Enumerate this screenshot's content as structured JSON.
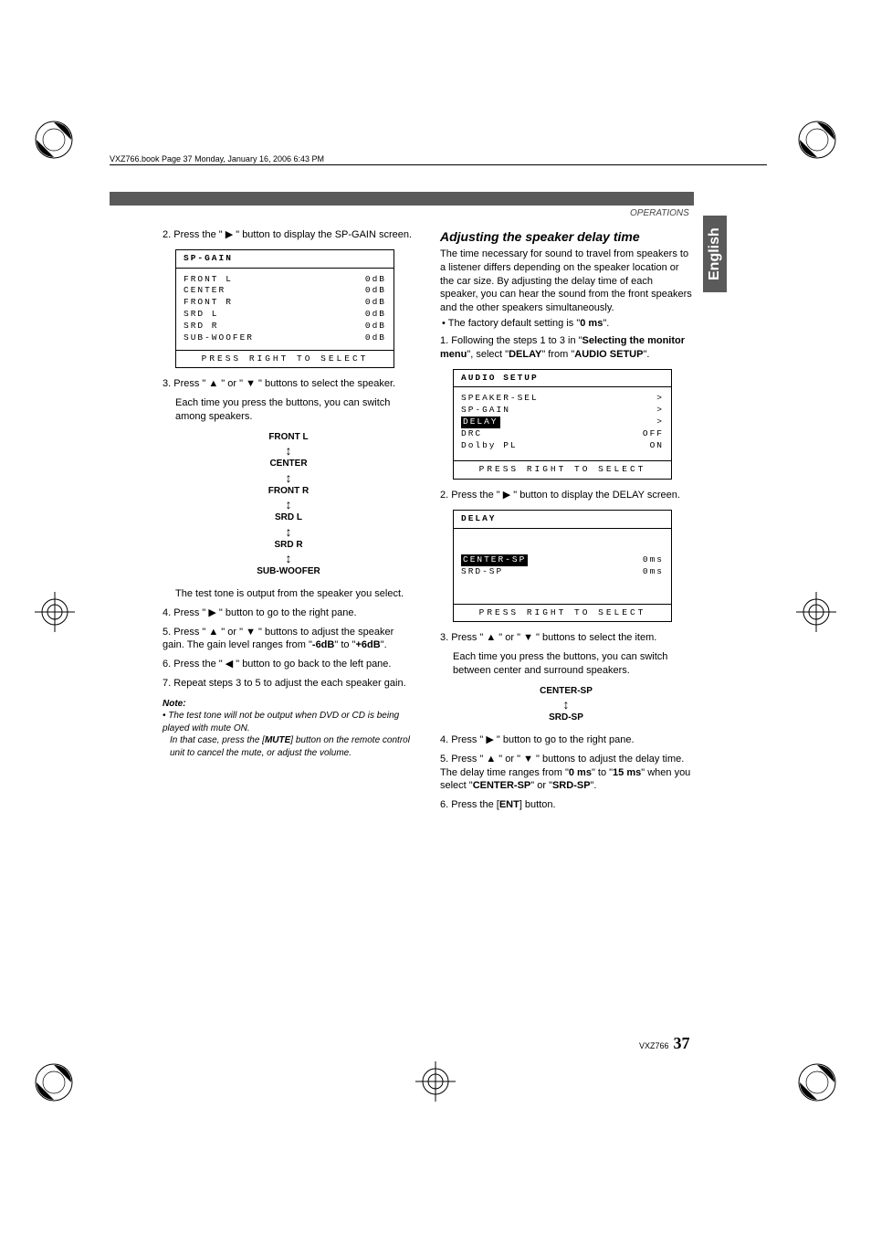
{
  "header": "VXZ766.book  Page 37  Monday, January 16, 2006  6:43 PM",
  "topLabel": "OPERATIONS",
  "sideTab": "English",
  "left": {
    "step2": "2. Press the \" ▶ \" button to display the SP-GAIN screen.",
    "menu1": {
      "title": "SP-GAIN",
      "rows": [
        {
          "lbl": "FRONT L",
          "val": "0dB"
        },
        {
          "lbl": "CENTER",
          "val": "0dB"
        },
        {
          "lbl": "FRONT R",
          "val": "0dB"
        },
        {
          "lbl": "SRD L",
          "val": "0dB"
        },
        {
          "lbl": "SRD R",
          "val": "0dB"
        },
        {
          "lbl": "SUB-WOOFER",
          "val": "0dB"
        }
      ],
      "footer": "PRESS RIGHT TO SELECT"
    },
    "step3a": "3. Press \" ▲ \" or \" ▼ \" buttons to select the speaker.",
    "step3b": "Each time you press the buttons, you can switch among speakers.",
    "flow": [
      "FRONT L",
      "CENTER",
      "FRONT R",
      "SRD L",
      "SRD R",
      "SUB-WOOFER"
    ],
    "afterFlow": "The test tone is output from the speaker you select.",
    "step4": "4. Press \" ▶ \" button to go to the right pane.",
    "step5a": "5. Press \" ▲ \" or \" ▼ \" buttons to adjust the speaker gain. The gain level ranges from \"",
    "step5b": "-6dB",
    "step5c": "\" to \"",
    "step5d": "+6dB",
    "step5e": "\".",
    "step6": "6. Press the \" ◀ \" button to go back to the left pane.",
    "step7": "7. Repeat steps 3 to 5 to adjust the each speaker gain.",
    "noteHd": "Note:",
    "note1": "• The test tone will not be output when DVD or CD is being played with mute ON.",
    "note2a": "In that case, press the [",
    "note2b": "MUTE",
    "note2c": "] button on the remote control unit to cancel the mute, or adjust the volume."
  },
  "right": {
    "title": "Adjusting the speaker delay time",
    "intro": "The time necessary for sound to travel from speakers to a listener differs depending on the speaker location or the car size. By adjusting the delay time of each speaker, you can hear the sound from the front speakers and the other speakers simultaneously.",
    "bullet1a": "The factory default setting is \"",
    "bullet1b": "0 ms",
    "bullet1c": "\".",
    "step1a": "1. Following the steps 1 to 3 in \"",
    "step1b": "Selecting the monitor menu",
    "step1c": "\", select \"",
    "step1d": "DELAY",
    "step1e": "\" from \"",
    "step1f": "AUDIO SETUP",
    "step1g": "\".",
    "menu1": {
      "title": "AUDIO SETUP",
      "rows": [
        {
          "lbl": "SPEAKER-SEL",
          "val": ">"
        },
        {
          "lbl": "SP-GAIN",
          "val": ">"
        },
        {
          "lbl": "DELAY",
          "val": ">",
          "hi": true
        },
        {
          "lbl": "DRC",
          "val": "OFF"
        },
        {
          "lbl": "Dolby PL",
          "val": "ON"
        }
      ],
      "footer": "PRESS RIGHT TO SELECT"
    },
    "step2": "2. Press the \" ▶ \" button to display the DELAY screen.",
    "menu2": {
      "title": "DELAY",
      "rows": [
        {
          "lbl": "CENTER-SP",
          "val": "0ms",
          "hi": true
        },
        {
          "lbl": "SRD-SP",
          "val": "0ms"
        }
      ],
      "footer": "PRESS RIGHT TO SELECT"
    },
    "step3a": "3. Press \" ▲ \" or \" ▼ \" buttons to select the item.",
    "step3b": "Each time you press the buttons, you can switch between center and surround speakers.",
    "flow": [
      "CENTER-SP",
      "SRD-SP"
    ],
    "step4": "4. Press \" ▶ \" button to go to the right pane.",
    "step5a": "5. Press \" ▲ \" or \" ▼ \" buttons to adjust the delay time. The delay time ranges from \"",
    "step5b": "0 ms",
    "step5c": "\" to \"",
    "step5d": "15 ms",
    "step5e": "\" when you select \"",
    "step5f": "CENTER-SP",
    "step5g": "\" or \"",
    "step5h": "SRD-SP",
    "step5i": "\".",
    "step6a": "6. Press the [",
    "step6b": "ENT",
    "step6c": "] button."
  },
  "pageNum": {
    "model": "VXZ766",
    "num": "37"
  }
}
